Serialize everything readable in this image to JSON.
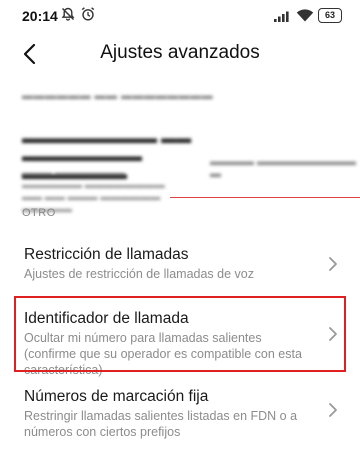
{
  "status_bar": {
    "time": "20:14",
    "battery": "63",
    "icons": [
      "muted-bell-icon",
      "alarm-clock-icon",
      "signal-icon",
      "wifi-icon",
      "battery-icon"
    ]
  },
  "header": {
    "title": "Ajustes avanzados",
    "back_icon": "back-arrow-icon"
  },
  "section": {
    "title": "OTRO"
  },
  "settings": [
    {
      "title": "Restricción de llamadas",
      "description": "Ajustes de restricción de llamadas de voz"
    },
    {
      "title": "Identificador de llamada",
      "description": "Ocultar mi número para llamadas salientes (confirme que su operador es compatible con esta característica)",
      "highlighted": true
    },
    {
      "title": "Números de marcación fija",
      "description": "Restringir llamadas salientes listadas en FDN o a números con ciertos prefijos"
    }
  ],
  "colors": {
    "highlight": "#e02020",
    "divider": "#e04040",
    "description": "#8c8c8c",
    "section_header": "#888888"
  }
}
